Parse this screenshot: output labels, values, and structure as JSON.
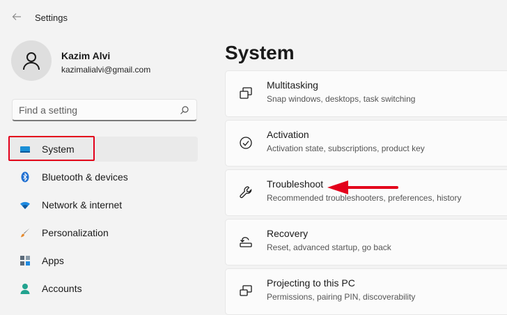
{
  "window": {
    "title": "Settings"
  },
  "user": {
    "name": "Kazim Alvi",
    "email": "kazimalialvi@gmail.com"
  },
  "search": {
    "placeholder": "Find a setting"
  },
  "nav": {
    "items": [
      {
        "label": "System",
        "icon": "system-display-icon",
        "selected": true
      },
      {
        "label": "Bluetooth & devices",
        "icon": "bluetooth-icon"
      },
      {
        "label": "Network & internet",
        "icon": "wifi-icon"
      },
      {
        "label": "Personalization",
        "icon": "brush-icon"
      },
      {
        "label": "Apps",
        "icon": "apps-icon"
      },
      {
        "label": "Accounts",
        "icon": "person-icon"
      }
    ]
  },
  "main": {
    "title": "System",
    "cards": [
      {
        "title": "Multitasking",
        "desc": "Snap windows, desktops, task switching",
        "icon": "multitasking-icon"
      },
      {
        "title": "Activation",
        "desc": "Activation state, subscriptions, product key",
        "icon": "checkmark-circle-icon"
      },
      {
        "title": "Troubleshoot",
        "desc": "Recommended troubleshooters, preferences, history",
        "icon": "wrench-icon"
      },
      {
        "title": "Recovery",
        "desc": "Reset, advanced startup, go back",
        "icon": "recovery-icon"
      },
      {
        "title": "Projecting to this PC",
        "desc": "Permissions, pairing PIN, discoverability",
        "icon": "projecting-icon"
      }
    ]
  },
  "colors": {
    "highlight": "#e3001b",
    "accent": "#0067c0"
  }
}
